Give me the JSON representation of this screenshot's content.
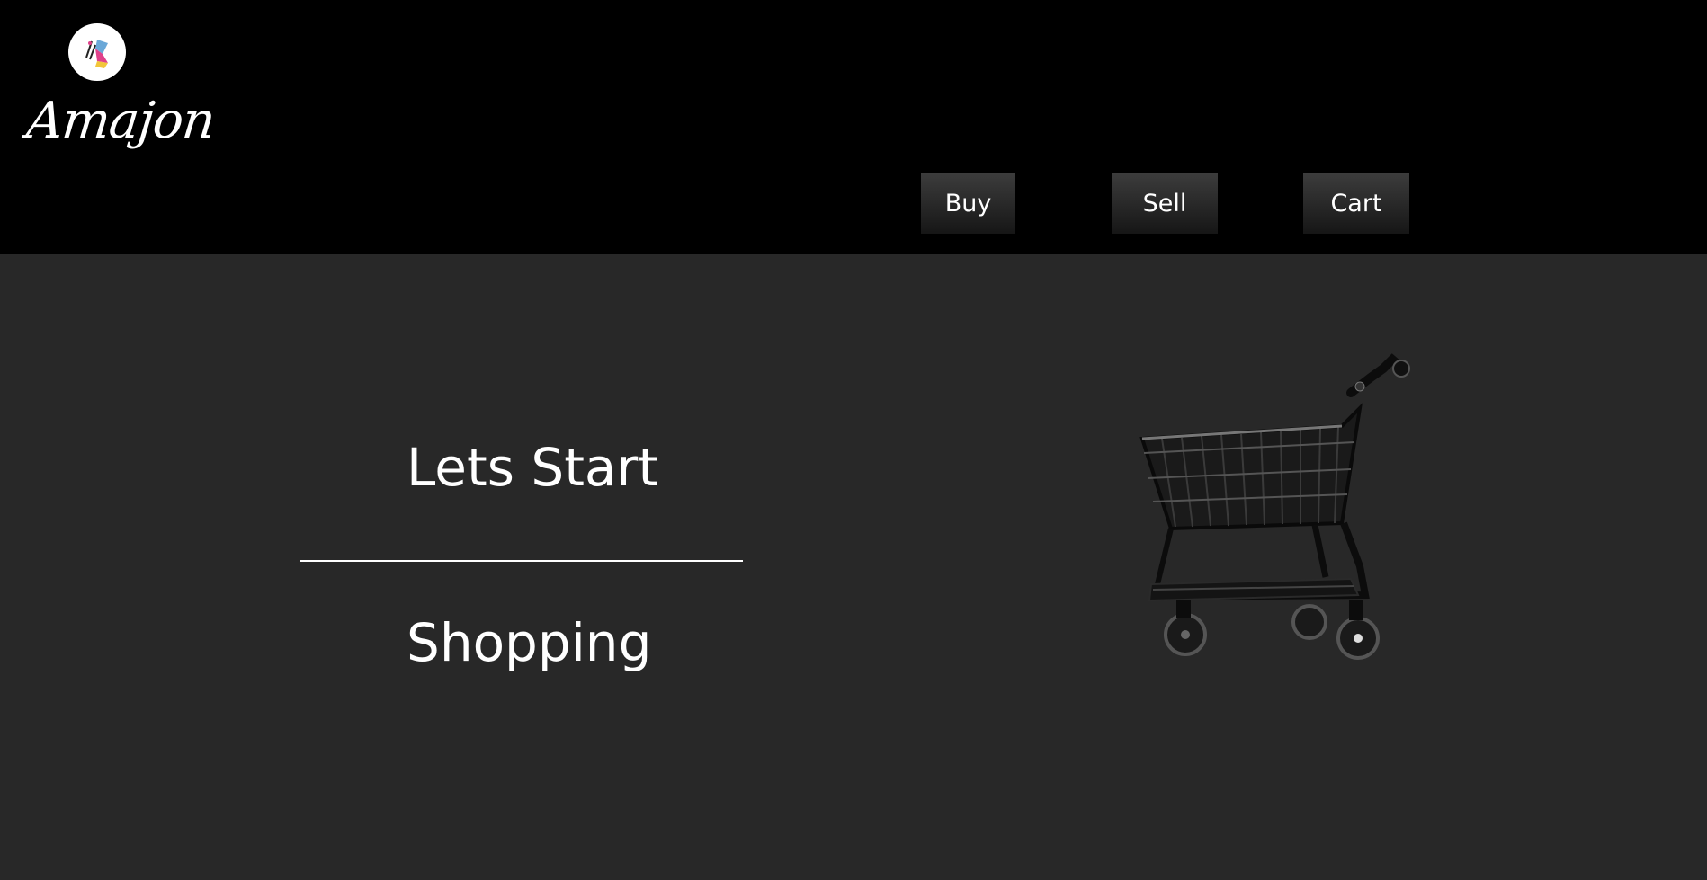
{
  "brand": {
    "name": "Amajon",
    "colors": {
      "header_bg": "#000000",
      "page_bg": "#282828",
      "text": "#ffffff"
    }
  },
  "nav": {
    "items": [
      {
        "label": "Buy"
      },
      {
        "label": "Sell"
      },
      {
        "label": "Cart"
      }
    ]
  },
  "hero": {
    "line1": "Lets Start",
    "line2": "Shopping",
    "image": "shopping-cart-illustration"
  }
}
